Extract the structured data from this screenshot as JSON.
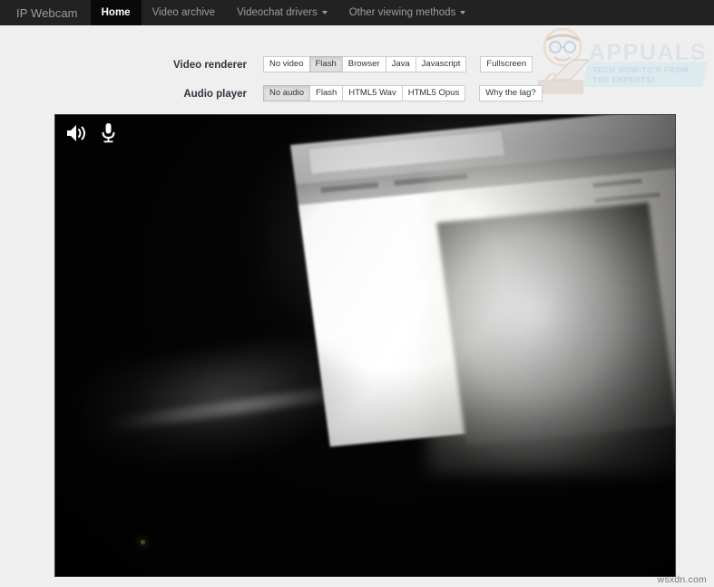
{
  "navbar": {
    "brand": "IP Webcam",
    "items": [
      {
        "label": "Home",
        "active": true,
        "caret": false
      },
      {
        "label": "Video archive",
        "active": false,
        "caret": false
      },
      {
        "label": "Videochat drivers",
        "active": false,
        "caret": true
      },
      {
        "label": "Other viewing methods",
        "active": false,
        "caret": true
      }
    ]
  },
  "watermark": {
    "title": "APPUALS",
    "tagline": "TECH HOW-TO'S FROM THE EXPERTS!"
  },
  "controls": {
    "video_renderer": {
      "label": "Video renderer",
      "options": [
        {
          "label": "No video",
          "active": false
        },
        {
          "label": "Flash",
          "active": true
        },
        {
          "label": "Browser",
          "active": false
        },
        {
          "label": "Java",
          "active": false
        },
        {
          "label": "Javascript",
          "active": false
        }
      ],
      "standalone": {
        "label": "Fullscreen"
      }
    },
    "audio_player": {
      "label": "Audio player",
      "options": [
        {
          "label": "No audio",
          "active": true
        },
        {
          "label": "Flash",
          "active": false
        },
        {
          "label": "HTML5 Wav",
          "active": false
        },
        {
          "label": "HTML5 Opus",
          "active": false
        }
      ],
      "standalone": {
        "label": "Why the lag?"
      }
    }
  },
  "player": {
    "speaker_icon": "speaker-volume-icon",
    "microphone_icon": "microphone-icon"
  },
  "footer": {
    "url": "wsxdn.com"
  },
  "colors": {
    "navbar_bg": "#222222",
    "navbar_active_bg": "#090909",
    "navbar_text": "#9d9d9d",
    "page_bg": "#efefef",
    "button_bg": "#ffffff",
    "button_active_bg": "#e0e0e0",
    "button_border": "#cccccc",
    "label_text": "#333340",
    "video_bg": "#000000",
    "watermark_accent": "#bfe0ec"
  }
}
